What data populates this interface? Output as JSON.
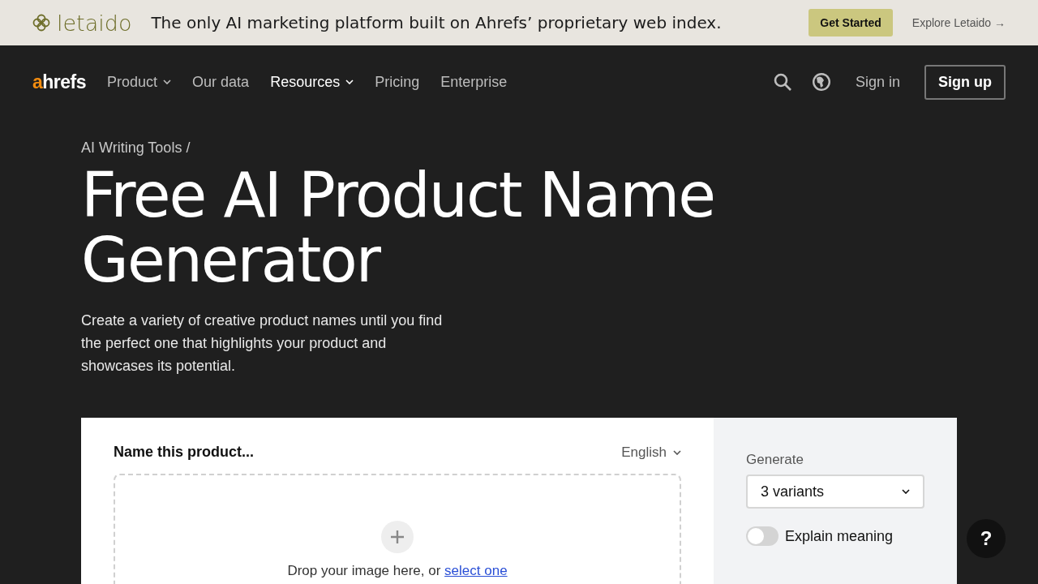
{
  "promo_banner": {
    "brand": "letaido",
    "message": "The only AI marketing platform built on Ahrefs’ proprietary web index.",
    "cta": "Get Started",
    "link": "Explore Letaido →"
  },
  "nav": {
    "logo": {
      "accent": "a",
      "rest": "hrefs"
    },
    "items": [
      {
        "label": "Product",
        "dropdown": true,
        "selected": false
      },
      {
        "label": "Our data",
        "dropdown": false,
        "selected": false
      },
      {
        "label": "Resources",
        "dropdown": true,
        "selected": true
      },
      {
        "label": "Pricing",
        "dropdown": false,
        "selected": false
      },
      {
        "label": "Enterprise",
        "dropdown": false,
        "selected": false
      }
    ],
    "sign_in": "Sign in",
    "sign_up": "Sign up"
  },
  "breadcrumb": "AI Writing Tools /",
  "title": "Free AI Product Name Generator",
  "description": "Create a variety of creative product names until you find the perfect one that highlights your product and showcases its potential.",
  "tool": {
    "heading": "Name this product...",
    "language": "English",
    "drop_text": "Drop your image here, or ",
    "drop_link": "select one",
    "generate_label": "Generate",
    "variants": "3 variants",
    "toggle": {
      "label": "Explain meaning",
      "on": false
    }
  },
  "help_button": "?"
}
